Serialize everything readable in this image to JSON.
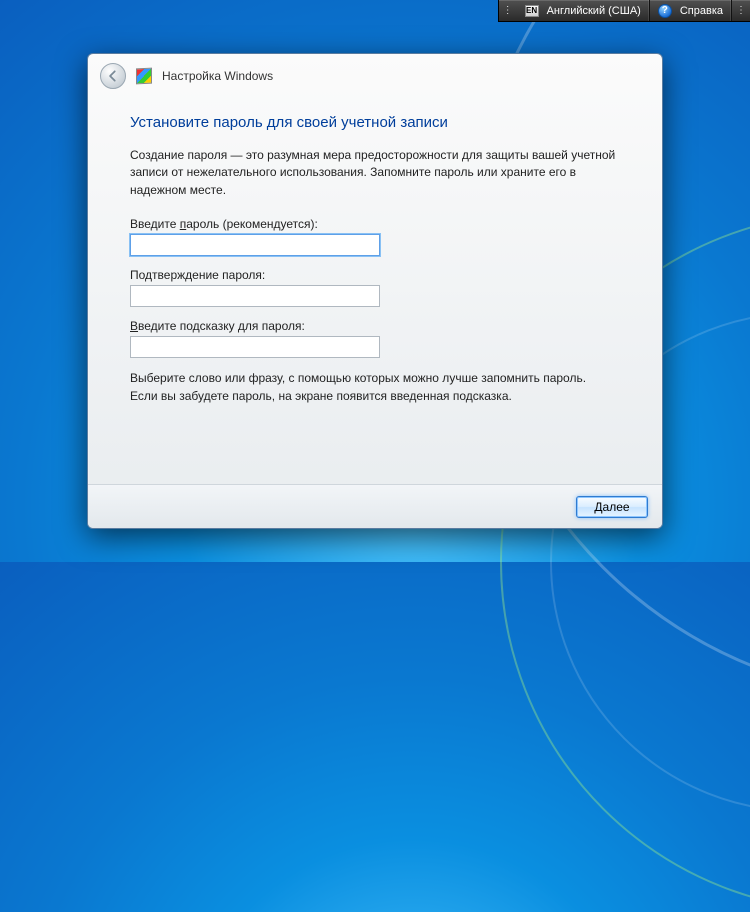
{
  "topbar": {
    "lang_code": "EN",
    "lang_label": "Английский (США)",
    "help_label": "Справка"
  },
  "wizard": {
    "header_title": "Настройка Windows",
    "headline": "Установите пароль для своей учетной записи",
    "intro": "Создание пароля — это разумная мера предосторожности для защиты вашей учетной записи от нежелательного использования. Запомните пароль или храните его в надежном месте.",
    "fields": {
      "password_label_pre": "Введите ",
      "password_label_u": "п",
      "password_label_post": "ароль (рекомендуется):",
      "password_value": "",
      "confirm_label": "Подтверждение пароля:",
      "confirm_value": "",
      "hint_label_pre": "",
      "hint_label_u": "В",
      "hint_label_post": "ведите подсказку для пароля:",
      "hint_value": ""
    },
    "assist_line1": "Выберите слово или фразу, с помощью которых можно лучше запомнить пароль.",
    "assist_line2": "Если вы забудете пароль, на экране появится введенная подсказка.",
    "next_button_u": "Д",
    "next_button_post": "алее"
  }
}
